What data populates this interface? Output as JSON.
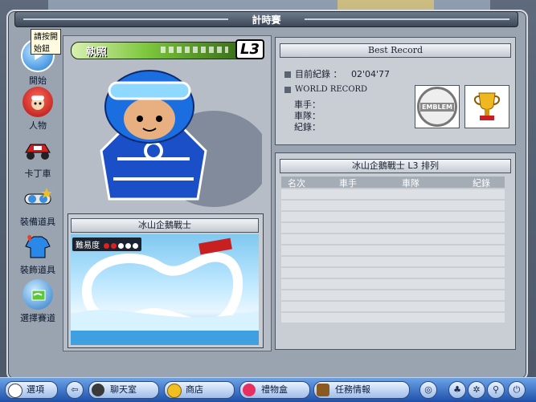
{
  "window": {
    "title": "計時賽"
  },
  "sidebar": {
    "tooltip": "請按開始鈕",
    "items": [
      {
        "label": "開始",
        "icon": "play-icon"
      },
      {
        "label": "人物",
        "icon": "character-icon"
      },
      {
        "label": "卡丁車",
        "icon": "kart-icon"
      },
      {
        "label": "裝備道具",
        "icon": "goggles-icon"
      },
      {
        "label": "裝飾道具",
        "icon": "outfit-icon"
      },
      {
        "label": "選擇賽道",
        "icon": "track-icon"
      }
    ]
  },
  "license": {
    "label": "執照",
    "level": "L3"
  },
  "track": {
    "name": "冰山企鵝戰士",
    "difficulty_label": "難易度",
    "difficulty_level": 2,
    "difficulty_max": 5
  },
  "record": {
    "header": "Best Record",
    "my_record_label": "目前紀錄 ：",
    "my_record_value": "02'04'77",
    "world_record_label": "WORLD RECORD",
    "driver_label": "車手：",
    "team_label": "車隊：",
    "record_label": "紀錄：",
    "emblem_text": "EMBLEM"
  },
  "ranking": {
    "header": "冰山企鵝戰士 L3 排列",
    "columns": [
      "名次",
      "車手",
      "車隊",
      "紀錄"
    ]
  },
  "taskbar": {
    "options_label": "選項",
    "chat_label": "聊天室",
    "shop_label": "商店",
    "gift_label": "禮物盒",
    "mission_label": "任務情報"
  },
  "colors": {
    "taskbar": "#1d4fa8",
    "license_green": "#7cc63c",
    "difficulty_on": "#e02020",
    "difficulty_off": "#ffffff"
  }
}
